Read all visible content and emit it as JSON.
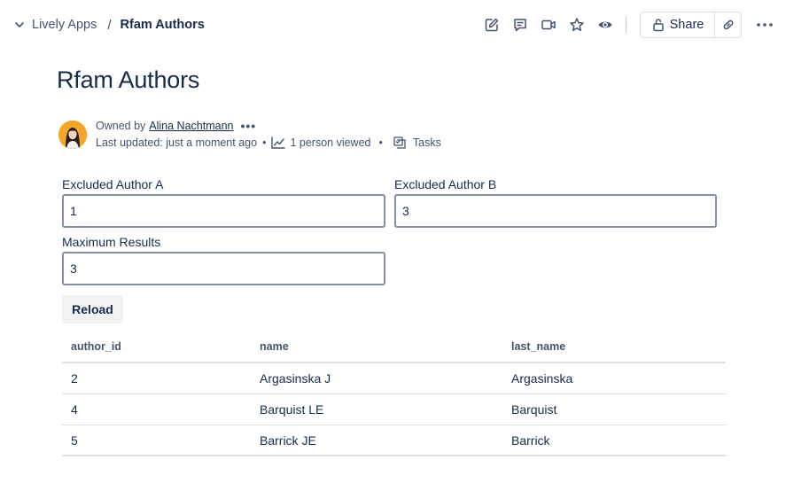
{
  "breadcrumb": {
    "space": "Lively Apps",
    "separator": "/",
    "page": "Rfam Authors"
  },
  "toolbar": {
    "share_label": "Share",
    "icons": [
      "edit-icon",
      "comment-icon",
      "video-icon",
      "star-icon",
      "watch-icon",
      "lock-icon",
      "link-icon",
      "more-icon"
    ]
  },
  "page": {
    "title": "Rfam Authors"
  },
  "byline": {
    "owned_by_label": "Owned by",
    "owner": "Alina Nachtmann",
    "more": "•••",
    "last_updated": "Last updated: just a moment ago",
    "dot": "•",
    "viewers": "1 person viewed",
    "tasks": "Tasks"
  },
  "form": {
    "excluded_a": {
      "label": "Excluded Author A",
      "value": "1"
    },
    "excluded_b": {
      "label": "Excluded Author B",
      "value": "3"
    },
    "max_results": {
      "label": "Maximum Results",
      "value": "3"
    },
    "reload_label": "Reload"
  },
  "table": {
    "columns": [
      "author_id",
      "name",
      "last_name"
    ],
    "rows": [
      [
        "2",
        "Argasinska J",
        "Argasinska"
      ],
      [
        "4",
        "Barquist LE",
        "Barquist"
      ],
      [
        "5",
        "Barrick JE",
        "Barrick"
      ]
    ]
  },
  "colors": {
    "text": "#172b4d",
    "subtle": "#44546f",
    "border": "#8590a2",
    "avatar_bg": "#f4a62a"
  }
}
